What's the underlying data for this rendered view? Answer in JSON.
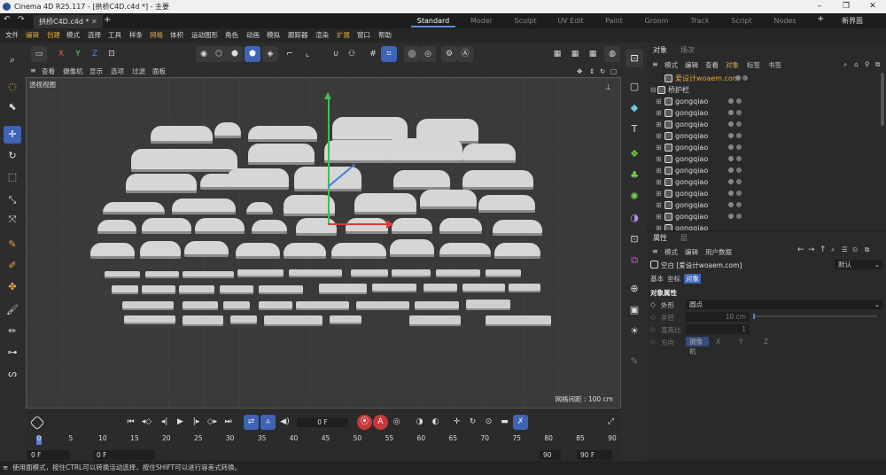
{
  "window": {
    "title": "Cinema 4D R25.117 - [拱桥C4D.c4d *] - 主要",
    "minimize": "–",
    "maximize": "❐",
    "close": "✕"
  },
  "tabs": {
    "doc_tab": "拱桥C4D.c4d *",
    "new_tab": "+",
    "layouts": [
      "Standard",
      "Model",
      "Sculpt",
      "UV Edit",
      "Paint",
      "Groom",
      "Track",
      "Script",
      "Nodes"
    ],
    "add_layout": "+",
    "new_ui": "新界面"
  },
  "menu": [
    "文件",
    "编辑",
    "创建",
    "模式",
    "选择",
    "工具",
    "样条",
    "网格",
    "体积",
    "运动图形",
    "角色",
    "动画",
    "模拟",
    "跟踪器",
    "渲染",
    "扩展",
    "窗口",
    "帮助"
  ],
  "viewport": {
    "menu": [
      "查看",
      "摄像机",
      "显示",
      "选项",
      "过滤",
      "面板"
    ],
    "label": "透视视图",
    "grid_info": "网格间距 : 100 cm"
  },
  "timeline": {
    "current_frame": "0 F",
    "ruler_ticks": [
      "0",
      "5",
      "10",
      "15",
      "20",
      "25",
      "30",
      "35",
      "40",
      "45",
      "50",
      "55",
      "60",
      "65",
      "70",
      "75",
      "80",
      "85",
      "90"
    ],
    "start_field": "0 F",
    "start_field2": "0 F",
    "end_field": "90 F",
    "end_field2": "90 F"
  },
  "status": "使用面模式，按住CTRL可以转换活动选择，按住SHIFT可以进行容差式转换。",
  "objects": {
    "tabs": [
      "对象",
      "场次"
    ],
    "menu": [
      "模式",
      "编辑",
      "查看",
      "对象",
      "标签",
      "书签"
    ],
    "rows": [
      {
        "name": "爱设计woaem.com",
        "highlight": true
      },
      {
        "name": "桥护栏"
      },
      {
        "name": "gongqiao"
      },
      {
        "name": "gongqiao"
      },
      {
        "name": "gongqiao"
      },
      {
        "name": "gongqiao"
      },
      {
        "name": "gongqiao"
      },
      {
        "name": "gongqiao"
      },
      {
        "name": "gongqiao"
      },
      {
        "name": "gongqiao"
      },
      {
        "name": "gongqiao"
      },
      {
        "name": "gongqiao"
      },
      {
        "name": "gongqiao"
      },
      {
        "name": "gongqiao"
      }
    ]
  },
  "attributes": {
    "tabs": [
      "属性",
      "层"
    ],
    "menu": [
      "模式",
      "编辑",
      "用户数据"
    ],
    "object_name": "空白 [爱设计woaem.com]",
    "preset": "默认",
    "subtabs": [
      "基本",
      "坐标",
      "对象"
    ],
    "section": "对象属性",
    "shape_label": "外形",
    "shape_value": "圆点",
    "radius_label": "半径",
    "radius_value": "10 cm",
    "ratio_label": "宽高比",
    "ratio_value": "1",
    "orient_label": "方向",
    "orient_value": "摄像机",
    "axis_x": "X",
    "axis_y": "Y",
    "axis_z": "Z"
  }
}
